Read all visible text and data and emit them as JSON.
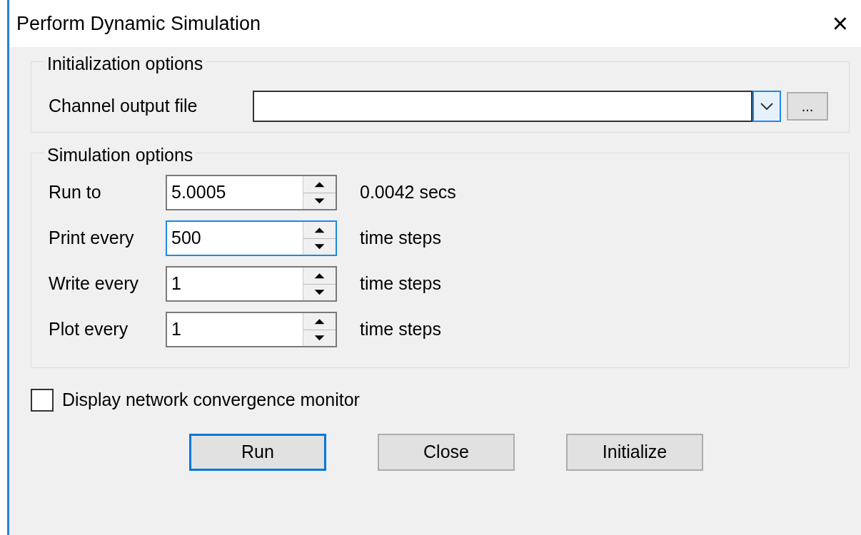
{
  "window": {
    "title": "Perform Dynamic Simulation",
    "close": "×"
  },
  "initialization": {
    "title": "Initialization options",
    "label": "Channel output file",
    "value_focused": false,
    "dropdown_focused": true,
    "browse": "..."
  },
  "simulation": {
    "title": "Simulation options",
    "rows": [
      {
        "label": "Run to",
        "value": "5.0005",
        "focused": false,
        "unit": "0.0042 secs"
      },
      {
        "label": "Print every",
        "value": "500",
        "focused": true,
        "unit": "time steps"
      },
      {
        "label": "Write every",
        "value": "1",
        "focused": false,
        "unit": "time steps"
      },
      {
        "label": "Plot every",
        "value": "1",
        "focused": false,
        "unit": "time steps"
      }
    ]
  },
  "monitor": {
    "label": "Display network convergence monitor",
    "checked": false
  },
  "buttons": [
    {
      "label": "Run",
      "focused": true
    },
    {
      "label": "Close",
      "focused": false
    },
    {
      "label": "Initialize",
      "focused": false
    }
  ]
}
